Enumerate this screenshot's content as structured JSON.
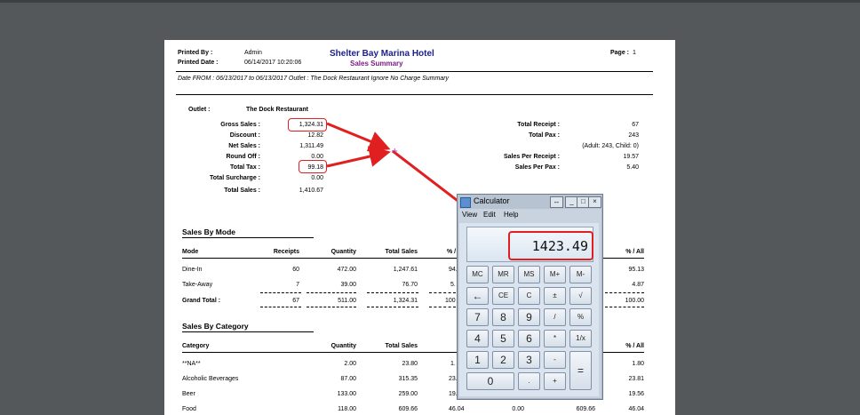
{
  "report": {
    "printed_by_label": "Printed By :",
    "printed_by": "Admin",
    "printed_date_label": "Printed Date :",
    "printed_date": "06/14/2017 10:20:06",
    "hotel": "Shelter Bay Marina Hotel",
    "subtitle": "Sales Summary",
    "page_label": "Page :",
    "page": "1",
    "date_line": "Date FROM : 06/13/2017 to 06/13/2017 Outlet : The Dock Restaurant  Ignore No Charge Summary",
    "outlet_label": "Outlet :",
    "outlet": "The Dock Restaurant",
    "summary_left": [
      {
        "label": "Gross Sales :",
        "value": "1,324.31"
      },
      {
        "label": "Discount :",
        "value": "12.82"
      },
      {
        "label": "Net Sales :",
        "value": "1,311.49"
      },
      {
        "label": "Round Off :",
        "value": "0.00"
      },
      {
        "label": "Total Tax :",
        "value": "99.18"
      },
      {
        "label": "Total Surcharge :",
        "value": "0.00"
      },
      {
        "label": "Total Sales :",
        "value": "1,410.67"
      }
    ],
    "summary_right": [
      {
        "label": "Total Receipt :",
        "value": "67"
      },
      {
        "label": "Total Pax :",
        "value": "243"
      },
      {
        "label": "",
        "value": "(Adult: 243, Child: 0)"
      },
      {
        "label": "Sales Per Receipt :",
        "value": "19.57"
      },
      {
        "label": "Sales Per Pax :",
        "value": "5.40"
      }
    ],
    "mode_title": "Sales By Mode",
    "mode_headers": {
      "mode": "Mode",
      "receipts": "Receipts",
      "quantity": "Quantity",
      "total_sales": "Total Sales",
      "pct_partial": "% /",
      "pct_all": "% / All"
    },
    "mode_rows": [
      {
        "mode": "Dine-In",
        "receipts": "60",
        "quantity": "472.00",
        "total_sales": "1,247.61",
        "pct": "94.",
        "pct_all": "95.13"
      },
      {
        "mode": "Take-Away",
        "receipts": "7",
        "quantity": "39.00",
        "total_sales": "76.70",
        "pct": "5.",
        "pct_all": "4.87"
      }
    ],
    "mode_total": {
      "label": "Grand Total :",
      "receipts": "67",
      "quantity": "511.00",
      "total_sales": "1,324.31",
      "pct": "100",
      "pct_all": "100.00"
    },
    "cat_title": "Sales By Category",
    "cat_headers": {
      "category": "Category",
      "quantity": "Quantity",
      "total_sales": "Total Sales",
      "pct_all": "% / All"
    },
    "cat_rows": [
      {
        "category": "**NA**",
        "quantity": "2.00",
        "total_sales": "23.80",
        "pct": "1.",
        "extra1": "",
        "extra2": "",
        "pct_all": "1.80"
      },
      {
        "category": "Alcoholic Beverages",
        "quantity": "87.00",
        "total_sales": "315.35",
        "pct": "23.",
        "extra1": "",
        "extra2": "",
        "pct_all": "23.81"
      },
      {
        "category": "Beer",
        "quantity": "133.00",
        "total_sales": "259.00",
        "pct": "19.",
        "extra1": "",
        "extra2": "",
        "pct_all": "19.56"
      },
      {
        "category": "Food",
        "quantity": "118.00",
        "total_sales": "609.66",
        "pct": "46.04",
        "extra1": "0.00",
        "extra2": "609.66",
        "pct_all": "46.04"
      }
    ]
  },
  "calculator": {
    "title": "Calculator",
    "menu": [
      "View",
      "Edit",
      "Help"
    ],
    "display": "1423.49",
    "keys": {
      "mc": "MC",
      "mr": "MR",
      "ms": "MS",
      "mplus": "M+",
      "mminus": "M-",
      "back": "←",
      "ce": "CE",
      "c": "C",
      "pm": "±",
      "sqrt": "√",
      "n7": "7",
      "n8": "8",
      "n9": "9",
      "div": "/",
      "pct": "%",
      "n4": "4",
      "n5": "5",
      "n6": "6",
      "mul": "*",
      "inv": "1/x",
      "n1": "1",
      "n2": "2",
      "n3": "3",
      "sub": "-",
      "eq": "=",
      "n0": "0",
      "dot": ".",
      "add": "+"
    }
  },
  "colors": {
    "annotation_red": "#e02020",
    "background": "#54585b"
  }
}
